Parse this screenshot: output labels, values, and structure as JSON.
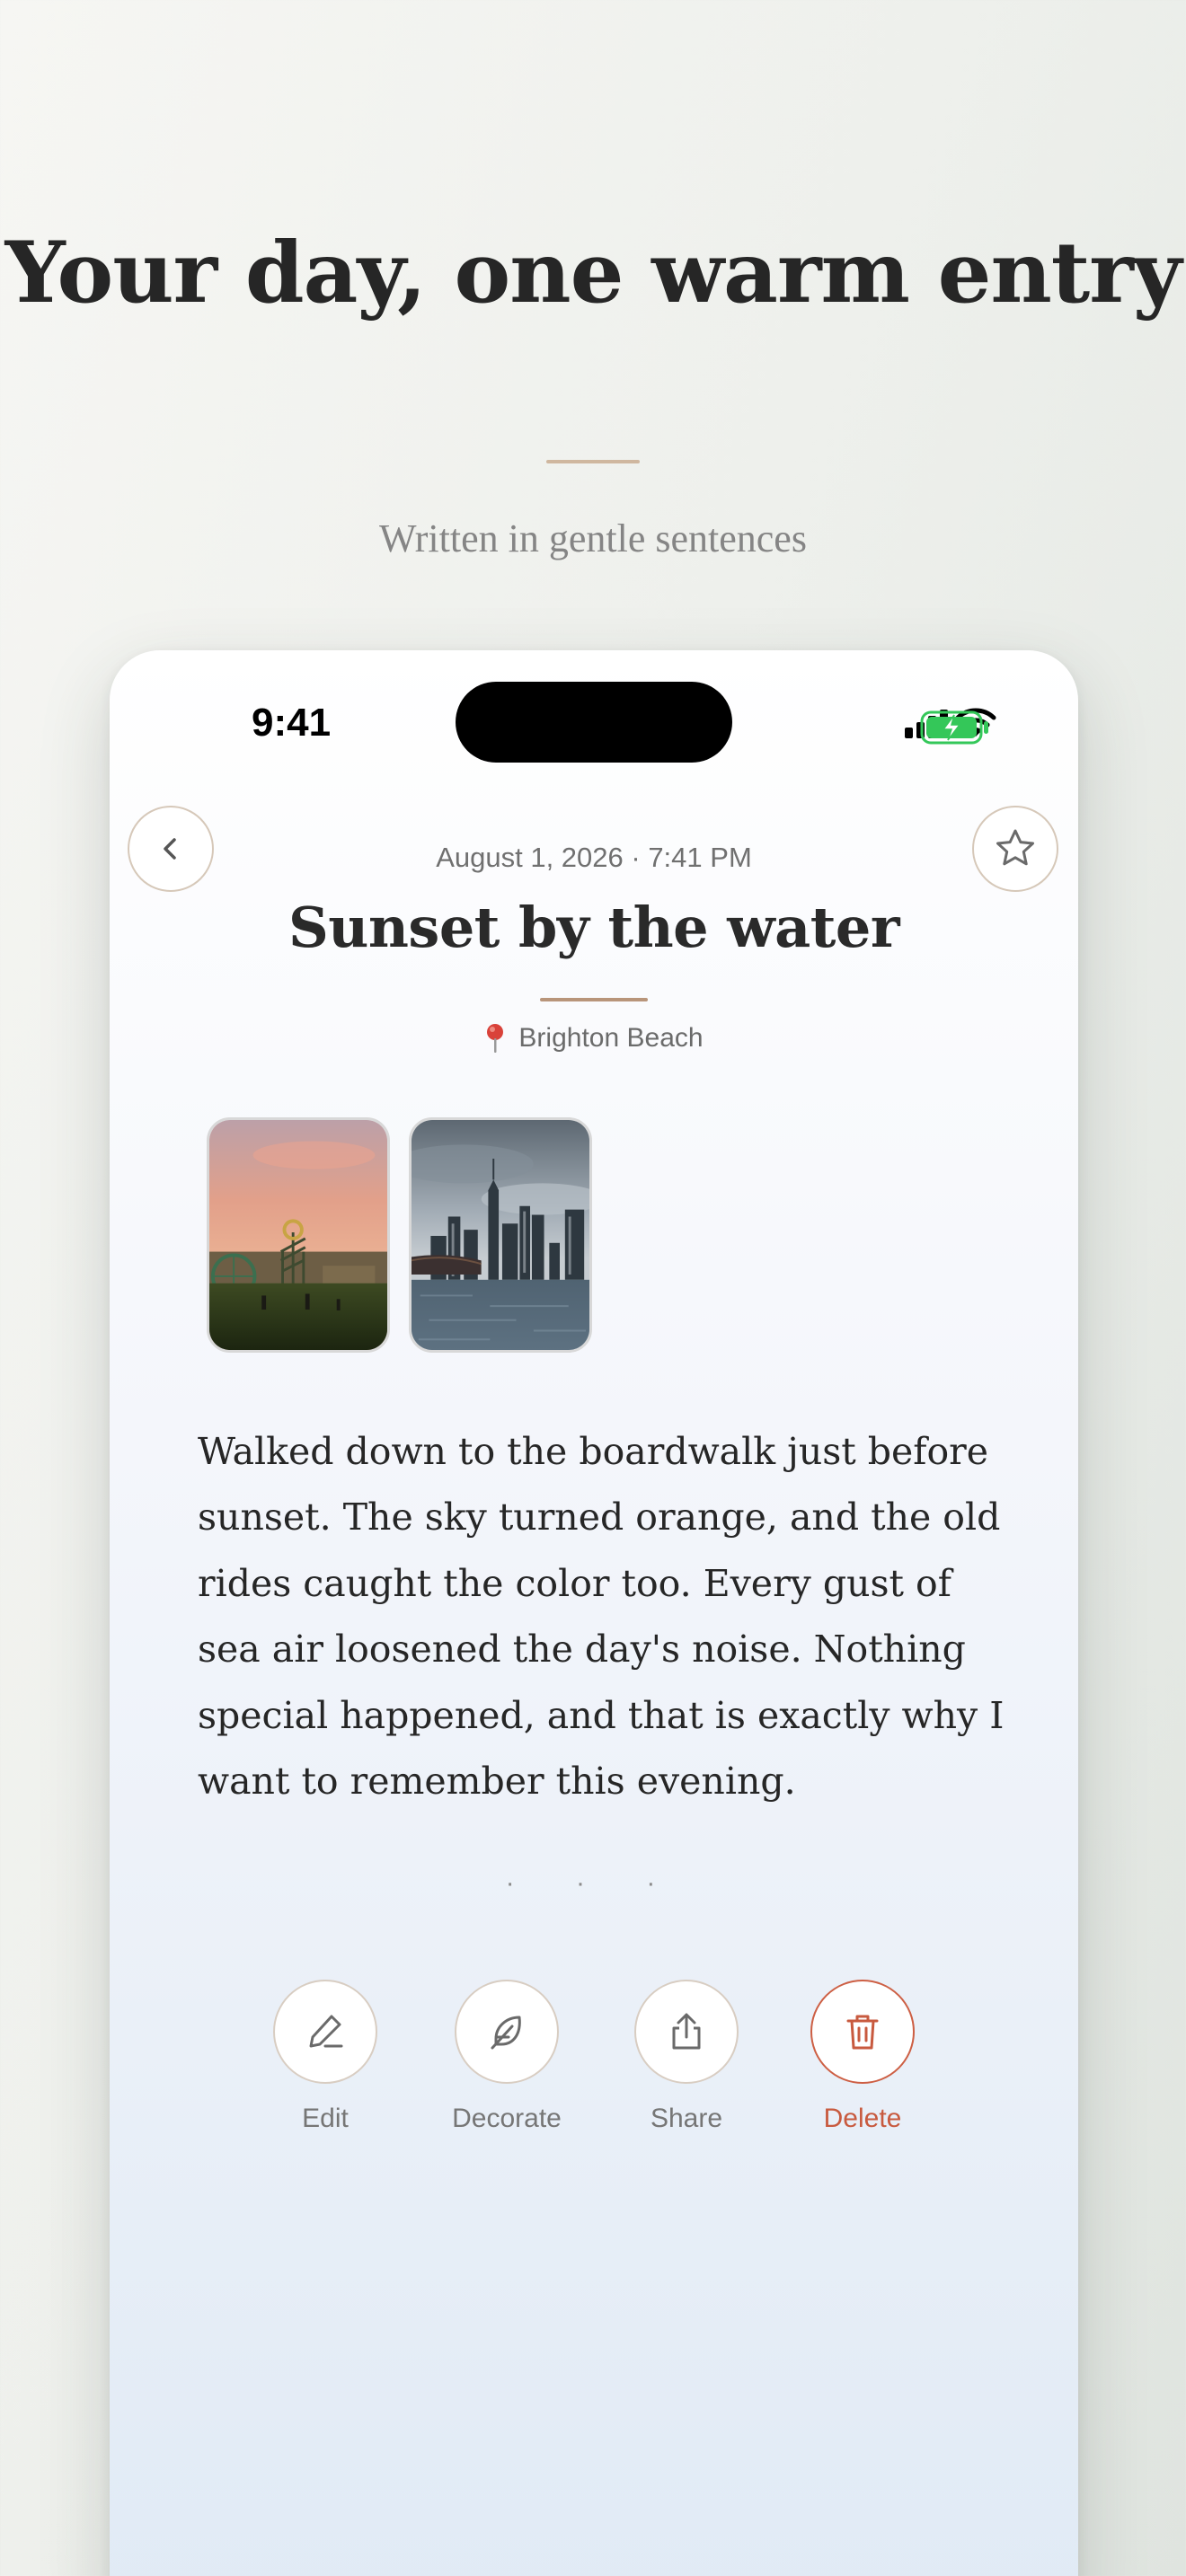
{
  "hero": {
    "title": "Your day, one warm entry",
    "subtitle": "Written in gentle sentences"
  },
  "status_bar": {
    "time": "9:41",
    "icons": [
      "cellular-signal-icon",
      "wifi-icon",
      "battery-charging-icon"
    ]
  },
  "nav": {
    "back_icon": "chevron-left-icon",
    "favorite_icon": "star-outline-icon"
  },
  "entry": {
    "meta": "August 1, 2026 · 7:41 PM",
    "title": "Sunset by the water",
    "location": "Brighton Beach",
    "location_icon": "map-pin-icon",
    "photos": [
      "amusement-park-sunset-photo",
      "city-skyline-river-photo"
    ],
    "body": "Walked down to the boardwalk just before sunset. The sky turned orange, and the old rides caught the color too. Every gust of sea air loosened the day's noise. Nothing special happened, and that is exactly why I want to remember this evening.",
    "separator": "· · ·"
  },
  "actions": [
    {
      "label": "Edit",
      "icon": "pencil-icon"
    },
    {
      "label": "Decorate",
      "icon": "feather-icon"
    },
    {
      "label": "Share",
      "icon": "share-icon"
    },
    {
      "label": "Delete",
      "icon": "trash-icon"
    }
  ],
  "colors": {
    "accent_tan": "#b8957a",
    "delete_red": "#c85a3f",
    "text_dark": "#262626",
    "battery_green": "#34c759"
  }
}
